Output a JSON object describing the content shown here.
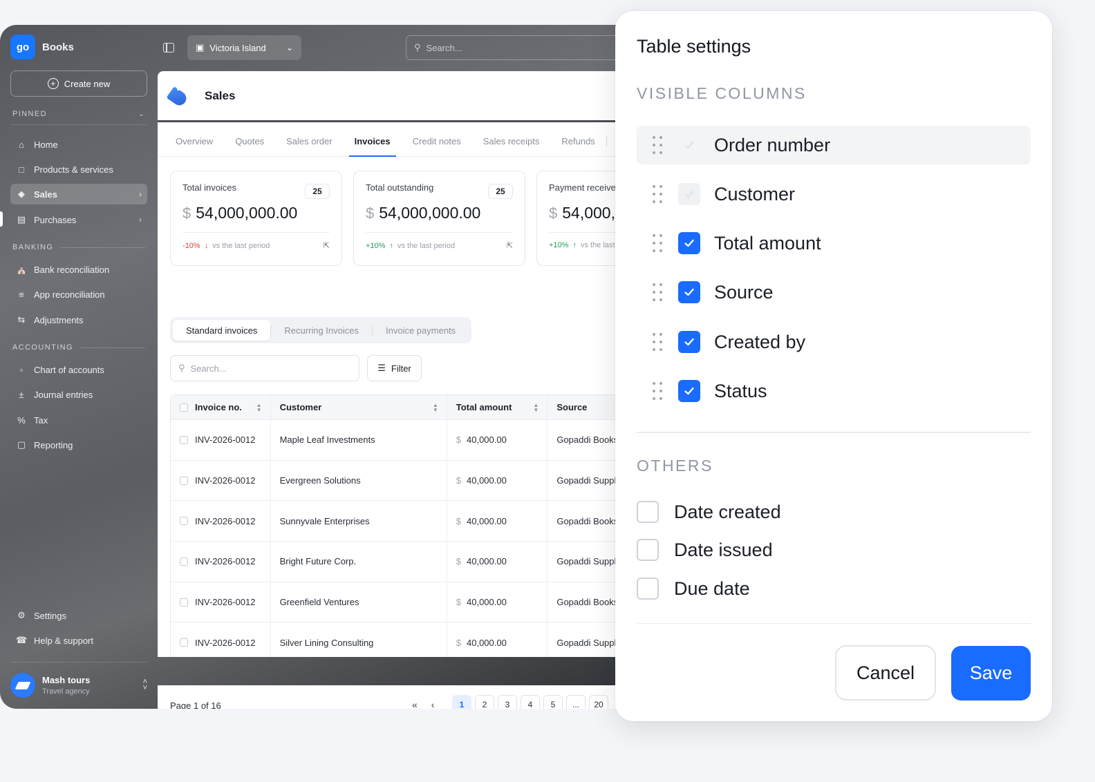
{
  "app": {
    "brand_logo": "go",
    "brand_name": "Books",
    "create_label": "Create new",
    "location": "Victoria Island",
    "search_placeholder": "Search..."
  },
  "sidebar": {
    "pinned_label": "PINNED",
    "pinned": [
      {
        "label": "Home",
        "icon": "home-icon"
      },
      {
        "label": "Products & services",
        "icon": "box-icon"
      },
      {
        "label": "Sales",
        "icon": "tag-icon",
        "active": true
      },
      {
        "label": "Purchases",
        "icon": "receipt-icon"
      }
    ],
    "banking_label": "BANKING",
    "banking": [
      {
        "label": "Bank reconciliation",
        "icon": "bank-icon"
      },
      {
        "label": "App reconciliation",
        "icon": "list-icon"
      },
      {
        "label": "Adjustments",
        "icon": "swap-icon"
      }
    ],
    "accounting_label": "ACCOUNTING",
    "accounting": [
      {
        "label": "Chart of accounts",
        "icon": "folder-icon"
      },
      {
        "label": "Journal entries",
        "icon": "plus-minus-icon"
      },
      {
        "label": "Tax",
        "icon": "percent-icon"
      },
      {
        "label": "Reporting",
        "icon": "presentation-icon"
      }
    ],
    "bottom": [
      {
        "label": "Settings",
        "icon": "gear-icon"
      },
      {
        "label": "Help & support",
        "icon": "headset-icon"
      }
    ],
    "user": {
      "name": "Mash tours",
      "subtitle": "Travel agency"
    }
  },
  "page": {
    "title": "Sales",
    "tabs": [
      "Overview",
      "Quotes",
      "Sales order",
      "Invoices",
      "Credit notes",
      "Sales receipts",
      "Refunds"
    ],
    "active_tab": "Invoices"
  },
  "cards": [
    {
      "title": "Total invoices",
      "badge": "25",
      "currency": "$",
      "amount": "54,000,000.00",
      "change": "-10%",
      "direction": "down",
      "vs": "vs the last period"
    },
    {
      "title": "Total outstanding",
      "badge": "25",
      "currency": "$",
      "amount": "54,000,000.00",
      "change": "+10%",
      "direction": "up",
      "vs": "vs the last period"
    },
    {
      "title": "Payment received",
      "badge": "",
      "currency": "$",
      "amount": "54,000,",
      "change": "+10%",
      "direction": "up",
      "vs": "vs the last"
    }
  ],
  "subtabs": [
    "Standard invoices",
    "Recurring Invoices",
    "Invoice payments"
  ],
  "table": {
    "search_placeholder": "Search...",
    "filter_label": "Filter",
    "columns": [
      "Invoice no.",
      "Customer",
      "Total amount",
      "Source"
    ],
    "rows": [
      {
        "invoice": "INV-2026-0012",
        "customer": "Maple Leaf Investments",
        "currency": "$",
        "amount": "40,000.00",
        "source": "Gopaddi Books"
      },
      {
        "invoice": "INV-2026-0012",
        "customer": "Evergreen Solutions",
        "currency": "$",
        "amount": "40,000.00",
        "source": "Gopaddi Suppl"
      },
      {
        "invoice": "INV-2026-0012",
        "customer": "Sunnyvale Enterprises",
        "currency": "$",
        "amount": "40,000.00",
        "source": "Gopaddi Books"
      },
      {
        "invoice": "INV-2026-0012",
        "customer": "Bright Future Corp.",
        "currency": "$",
        "amount": "40,000.00",
        "source": "Gopaddi Suppl"
      },
      {
        "invoice": "INV-2026-0012",
        "customer": "Greenfield Ventures",
        "currency": "$",
        "amount": "40,000.00",
        "source": "Gopaddi Books"
      },
      {
        "invoice": "INV-2026-0012",
        "customer": "Silver Lining Consulting",
        "currency": "$",
        "amount": "40,000.00",
        "source": "Gopaddi Suppl"
      }
    ]
  },
  "pagination": {
    "label": "Page 1 of 16",
    "first": "«",
    "prev": "‹",
    "pages": [
      "1",
      "2",
      "3",
      "4",
      "5",
      "...",
      "20"
    ],
    "active": "1"
  },
  "modal": {
    "title": "Table settings",
    "visible_label": "VISIBLE COLUMNS",
    "visible": [
      {
        "label": "Order number",
        "state": "locked-hidden"
      },
      {
        "label": "Customer",
        "state": "disabled"
      },
      {
        "label": "Total amount",
        "state": "checked"
      },
      {
        "label": "Source",
        "state": "checked"
      },
      {
        "label": "Created by",
        "state": "checked"
      },
      {
        "label": "Status",
        "state": "checked"
      }
    ],
    "others_label": "OTHERS",
    "others": [
      {
        "label": "Date created",
        "checked": false
      },
      {
        "label": "Date issued",
        "checked": false
      },
      {
        "label": "Due date",
        "checked": false
      }
    ],
    "cancel_label": "Cancel",
    "save_label": "Save",
    "accent": "#1a6bff"
  }
}
